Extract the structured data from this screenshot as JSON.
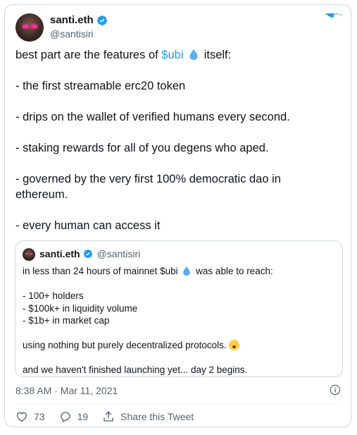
{
  "author": {
    "name": "santi.eth",
    "handle": "@santisiri"
  },
  "tweet": {
    "line1_prefix": "best part are the features of ",
    "line1_link": "$ubi",
    "line1_suffix": "itself:",
    "item1": "- the first streamable erc20 token",
    "item2": "- drips on the wallet of verified humans every second.",
    "item3": "- staking rewards for all of you degens who aped.",
    "item4_a": "- governed by the very first 100% democratic dao in",
    "item4_b": "ethereum.",
    "item5": "- every human can access it"
  },
  "quoted": {
    "name": "santi.eth",
    "handle": "@santisiri",
    "line1_prefix": "in less than 24 hours of mainnet $ubi",
    "line1_suffix": "was able to reach:",
    "list": [
      "- 100+ holders",
      "- $100k+ in liquidity volume",
      "- $1b+ in market cap"
    ],
    "line_protocols": "using nothing but purely decentralized protocols.",
    "line_last": "and we haven't finished launching yet... day 2 begins."
  },
  "meta": {
    "timestamp": "8:38 AM · Mar 11, 2021"
  },
  "actions": {
    "likes": "73",
    "replies": "19",
    "share_label": "Share this Tweet"
  },
  "colors": {
    "accent": "#1d9bf0",
    "text": "#0f1419",
    "muted": "#536471",
    "border": "#cfd9de"
  },
  "icons": [
    "verified-icon",
    "twitter-bird-icon",
    "water-drop-icon",
    "info-icon",
    "heart-icon",
    "reply-icon",
    "share-icon",
    "exploding-head-emoji"
  ]
}
